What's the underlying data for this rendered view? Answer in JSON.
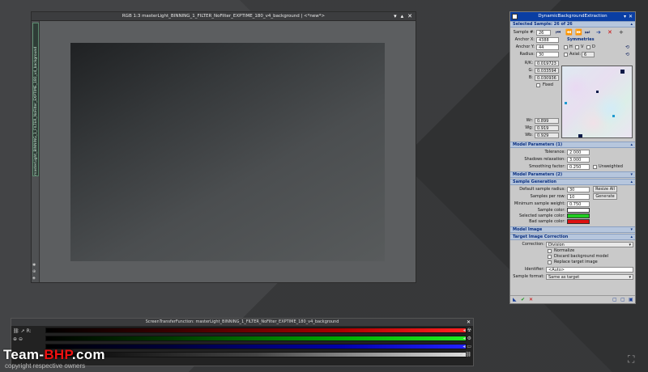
{
  "image_window": {
    "title": "RGB 1:3 masterLight_BINNING_1_FILTER_NoFilter_EXPTIME_180_v4_background | <*new*>",
    "side_tab": "masterLight_BINNING_1_FILTER_NoFilter_EXPTIME_180_v4_background",
    "buttons": [
      "▾",
      "▴",
      "✕"
    ]
  },
  "dbe": {
    "title": "DynamicBackgroundExtraction",
    "selected_sample": "Selected Sample: 26 of 26",
    "sample_label": "Sample #:",
    "sample_value": "26",
    "anchor_x_label": "Anchor X:",
    "anchor_x_value": "4388",
    "anchor_y_label": "Anchor Y:",
    "anchor_y_value": "44",
    "radius_label": "Radius:",
    "radius_value": "30",
    "symmetries_label": "Symmetries",
    "sym_h": "H",
    "sym_v": "V",
    "sym_d": "D",
    "axial_label": "Axial:",
    "axial_value": "6",
    "rk_label": "R/K:",
    "rk_value": "0.019723",
    "g_label": "G:",
    "g_value": "0.033594",
    "b_label": "B:",
    "b_value": "0.030936",
    "fixed_label": "Fixed",
    "wr_label": "Wr:",
    "wr_value": "0.899",
    "wg_label": "Wg:",
    "wg_value": "0.919",
    "wb_label": "Wb:",
    "wb_value": "0.929",
    "model_params1": "Model Parameters (1)",
    "tolerance_label": "Tolerance:",
    "tolerance_value": "2.000",
    "shadows_label": "Shadows relaxation:",
    "shadows_value": "3.000",
    "smoothing_label": "Smoothing factor:",
    "smoothing_value": "0.250",
    "unweighted_label": "Unweighted",
    "model_params2": "Model Parameters (2)",
    "sample_generation": "Sample Generation",
    "default_radius_label": "Default sample radius:",
    "default_radius_value": "30",
    "resize_all_label": "Resize All",
    "samples_per_row_label": "Samples per row:",
    "samples_per_row_value": "10",
    "generate_label": "Generate",
    "min_weight_label": "Minimum sample weight:",
    "min_weight_value": "0.750",
    "sample_color_label": "Sample color:",
    "selected_color_label": "Selected sample color:",
    "bad_color_label": "Bad sample color:",
    "model_image": "Model Image",
    "target_correction": "Target Image Correction",
    "correction_label": "Correction:",
    "correction_value": "Division",
    "normalize_label": "Normalize",
    "discard_label": "Discard background model",
    "replace_label": "Replace target image",
    "identifier_label": "Identifier:",
    "identifier_value": "<Auto>",
    "sample_format_label": "Sample format:",
    "sample_format_value": "Same as target",
    "colors": {
      "sample": "#ffffff",
      "selected": "#22cc22",
      "bad": "#dd1111",
      "title_bar": "#0a3ea3"
    }
  },
  "stf": {
    "title": "ScreenTransferFunction: masterLight_BINNING_1_FILTER_NoFilter_EXPTIME_180_v4_background",
    "channel_label": "R:"
  },
  "watermark": {
    "team": "Team-",
    "bhp": "BHP",
    "com": ".com",
    "sub": "copyright respective owners"
  }
}
